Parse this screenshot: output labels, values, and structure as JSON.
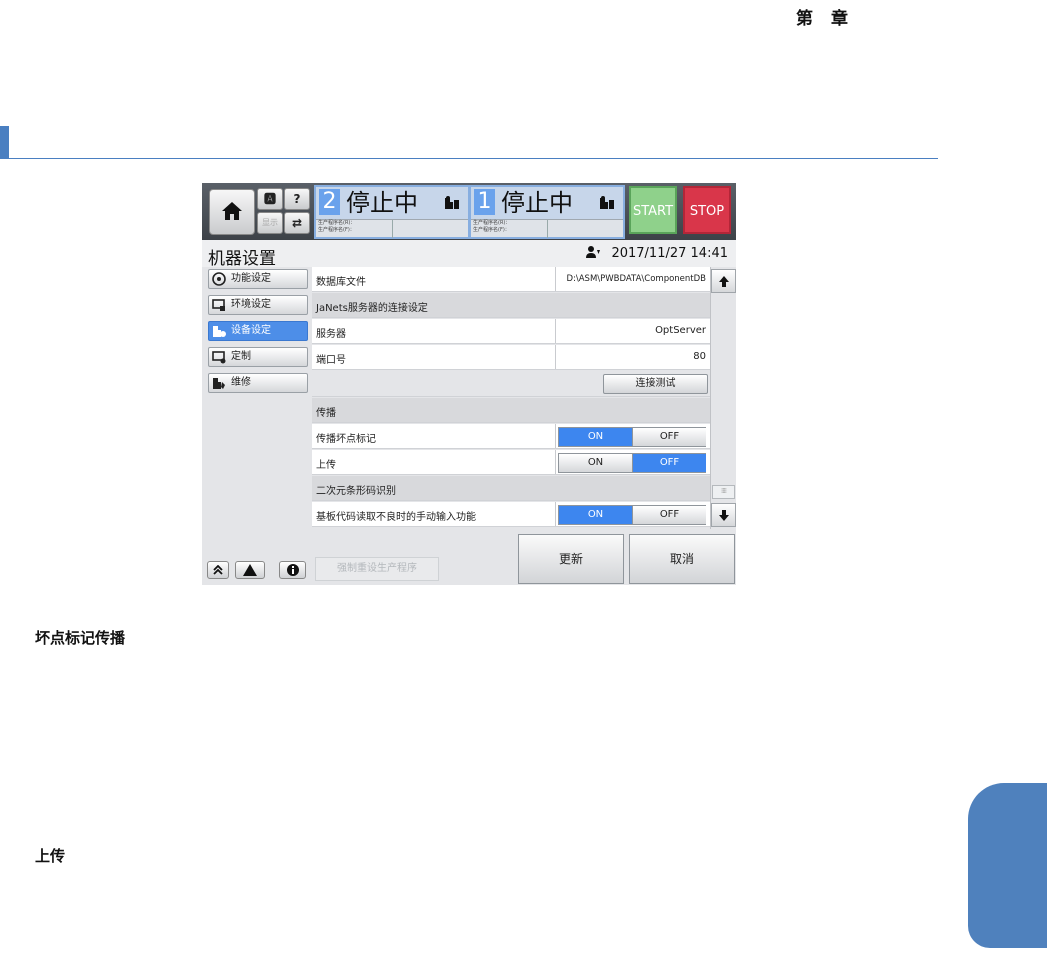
{
  "page": {
    "chapter_label_left": "第",
    "chapter_label_right": "章",
    "heading_1": "坏点标记传播",
    "heading_2": "上传",
    "accent_color": "#4a7fc1"
  },
  "screen": {
    "topbar": {
      "home_icon": "home-icon",
      "mini_buttons": [
        "🅰",
        "?",
        "显示",
        "⇄"
      ],
      "lanes": [
        {
          "number": "2",
          "status": "停止中",
          "icon": "feeder-icon",
          "info_front": "生产程序名(R)：",
          "info_rear": "生产程序名(F)："
        },
        {
          "number": "1",
          "status": "停止中",
          "icon": "feeder-icon",
          "info_front": "生产程序名(R)：",
          "info_rear": "生产程序名(F)："
        }
      ],
      "start_label": "START",
      "stop_label": "STOP"
    },
    "titlebar": {
      "title": "机器设置",
      "datetime": "2017/11/27 14:41"
    },
    "nav": {
      "items": [
        {
          "label": "功能设定",
          "icon": "function-settings-icon",
          "active": false
        },
        {
          "label": "环境设定",
          "icon": "environment-settings-icon",
          "active": false
        },
        {
          "label": "设备设定",
          "icon": "device-settings-icon",
          "active": true
        },
        {
          "label": "定制",
          "icon": "customize-icon",
          "active": false
        },
        {
          "label": "维修",
          "icon": "maintenance-icon",
          "active": false
        }
      ]
    },
    "settings": {
      "db_file_label": "数据库文件",
      "db_file_value": "D:\\ASM\\PWBDATA\\ComponentDB",
      "janets_group": "JaNets服务器的连接设定",
      "server_label": "服务器",
      "server_value": "OptServer",
      "port_label": "端口号",
      "port_value": "80",
      "connection_test": "连接测试",
      "propagation_group": "传播",
      "bad_mark_label": "传播坏点标记",
      "bad_mark_state": "ON",
      "upload_label": "上传",
      "upload_state": "OFF",
      "barcode_group": "二次元条形码识别",
      "manual_input_label": "基板代码读取不良时的手动输入功能",
      "manual_input_state": "ON",
      "on_label": "ON",
      "off_label": "OFF",
      "toggle_selected_color": "#3d86ef"
    },
    "footer": {
      "force_reset": "强制重设生产程序",
      "update": "更新",
      "cancel": "取消"
    }
  }
}
